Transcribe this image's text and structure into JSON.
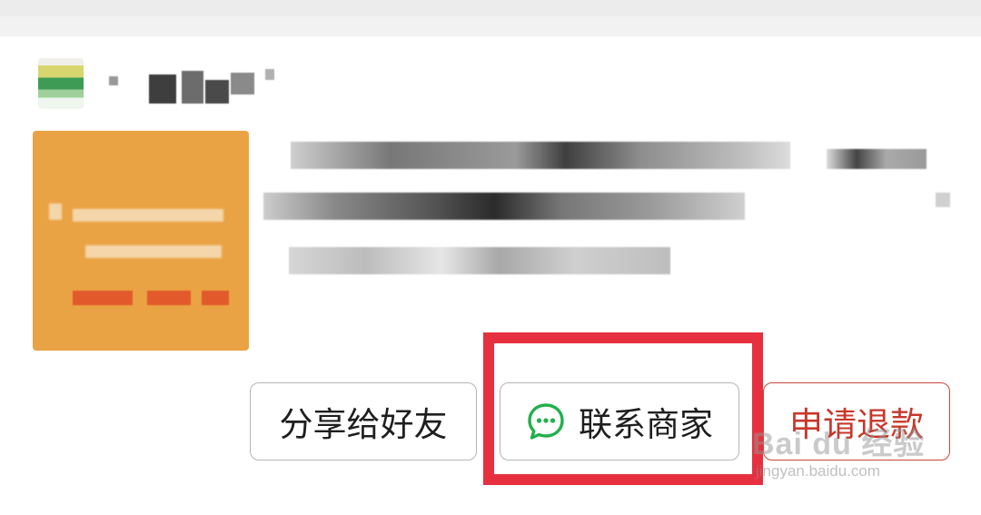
{
  "order_card": {
    "actions": {
      "share_label": "分享给好友",
      "contact_label": "联系商家",
      "refund_label": "申请退款"
    }
  },
  "icons": {
    "contact": "chat-bubble-icon"
  },
  "colors": {
    "highlight": "#e6303f",
    "refund_text": "#c7382b",
    "chat_icon": "#21b04b",
    "thumbnail": "#e9a344"
  },
  "watermark": {
    "main": "Bai du 经验",
    "sub": "jingyan.baidu.com"
  }
}
